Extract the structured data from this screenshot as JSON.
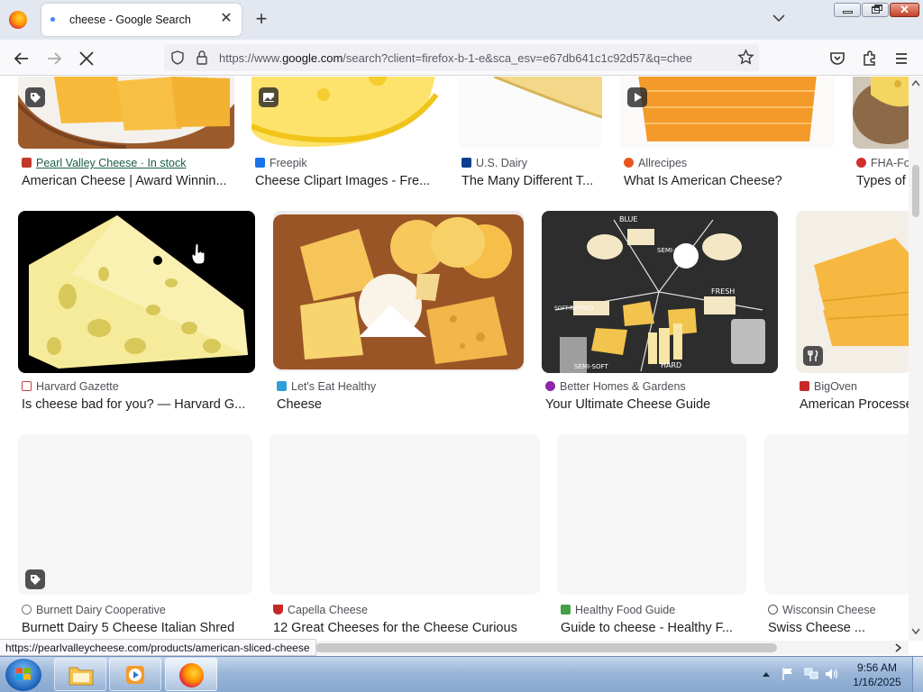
{
  "browser": {
    "tab_title": "cheese - Google Search",
    "url_prefix": "https://www.",
    "url_host": "google.com",
    "url_rest": "/search?client=firefox-b-1-e&sca_esv=e67db641c1c92d57&q=chee",
    "status_url": "https://pearlvalleycheese.com/products/american-sliced-cheese"
  },
  "results_row1": [
    {
      "source": "Pearl Valley Cheese · In stock",
      "title": "American Cheese | Award Winnin...",
      "fav_color": "#c0392b",
      "badge": "tag-icon"
    },
    {
      "source": "Freepik",
      "title": "Cheese Clipart Images - Fre...",
      "fav_color": "#1a73e8",
      "badge": "image-icon"
    },
    {
      "source": "U.S. Dairy",
      "title": "The Many Different T...",
      "fav_color": "#0b3d91",
      "badge": ""
    },
    {
      "source": "Allrecipes",
      "title": "What Is American Cheese?",
      "fav_color": "#e8551f",
      "badge": "play-icon"
    },
    {
      "source": "FHA-Fo",
      "title": "Types of",
      "fav_color": "#d32f2f",
      "badge": ""
    }
  ],
  "results_row2": [
    {
      "source": "Harvard Gazette",
      "title": "Is cheese bad for you? — Harvard G...",
      "fav_color": "#ffffff"
    },
    {
      "source": "Let's Eat Healthy",
      "title": "Cheese",
      "fav_color": "#2e9fd6"
    },
    {
      "source": "Better Homes & Gardens",
      "title": "Your Ultimate Cheese Guide",
      "fav_color": "#8e24aa"
    },
    {
      "source": "BigOven",
      "title": "American Processe",
      "fav_color": "#c62828",
      "badge": "utensils-icon"
    }
  ],
  "results_row3": [
    {
      "source": "Burnett Dairy Cooperative",
      "title": "Burnett Dairy 5 Cheese Italian Shred",
      "fav_color": "#777777",
      "badge": "tag-icon"
    },
    {
      "source": "Capella Cheese",
      "title": "12 Great Cheeses for the Cheese Curious",
      "fav_color": "#c62828"
    },
    {
      "source": "Healthy Food Guide",
      "title": "Guide to cheese - Healthy F...",
      "fav_color": "#43a047"
    },
    {
      "source": "Wisconsin Cheese",
      "title": "Swiss Cheese ...",
      "fav_color": "#555555"
    }
  ],
  "board_labels": [
    "BLUE",
    "SEMI-HARD",
    "SOFT-RIPENED",
    "FRESH",
    "SEMI-SOFT",
    "HARD"
  ],
  "taskbar": {
    "time": "9:56 AM",
    "date": "1/16/2025"
  }
}
